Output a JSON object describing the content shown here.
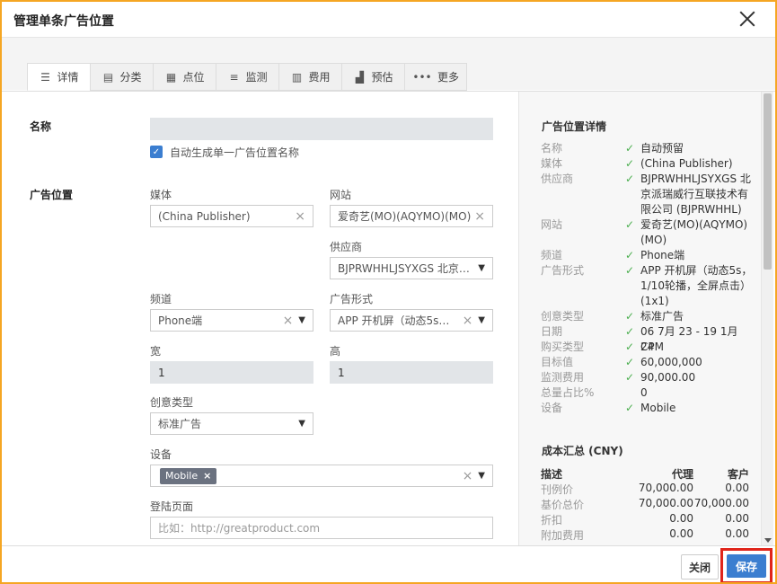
{
  "dialog": {
    "title": "管理单条广告位置"
  },
  "tabs": [
    {
      "label": "详情",
      "icon": "list-icon",
      "glyph": "☰"
    },
    {
      "label": "分类",
      "icon": "category-icon",
      "glyph": "▤"
    },
    {
      "label": "点位",
      "icon": "calendar-icon",
      "glyph": "▦"
    },
    {
      "label": "监测",
      "icon": "database-icon",
      "glyph": "≡"
    },
    {
      "label": "费用",
      "icon": "calculator-icon",
      "glyph": "▥"
    },
    {
      "label": "预估",
      "icon": "chart-icon",
      "glyph": "▟"
    },
    {
      "label": "更多",
      "icon": "more-icon",
      "glyph": "•••"
    }
  ],
  "form": {
    "name_label": "名称",
    "name_value": "",
    "auto_name_label": "自动生成单一广告位置名称",
    "placement_label": "广告位置",
    "media_label": "媒体",
    "media_value": "(China Publisher)",
    "site_label": "网站",
    "site_value": "爱奇艺(MO)(AQYMO)(MO)",
    "vendor_label": "供应商",
    "vendor_value": "BJPRWHHLJSYXGS 北京派瑞威行互联技术有限公司 (BJPRWHHL)",
    "channel_label": "频道",
    "channel_value": "Phone端",
    "format_label": "广告形式",
    "format_value": "APP 开机屏（动态5s，1/10轮播，全屏点击）(1x1)",
    "width_label": "宽",
    "width_value": "1",
    "height_label": "高",
    "height_value": "1",
    "creative_label": "创意类型",
    "creative_value": "标准广告",
    "device_label": "设备",
    "device_tag": "Mobile",
    "landing_label": "登陆页面",
    "landing_placeholder": "比如：http://greatproduct.com"
  },
  "details": {
    "title": "广告位置详情",
    "rows": [
      {
        "k": "名称",
        "v": "自动预留"
      },
      {
        "k": "媒体",
        "v": "(China Publisher)"
      },
      {
        "k": "供应商",
        "v": "BJPRWHHLJSYXGS 北京派瑞威行互联技术有限公司 (BJPRWHHL)"
      },
      {
        "k": "网站",
        "v": "爱奇艺(MO)(AQYMO)(MO)"
      },
      {
        "k": "频道",
        "v": "Phone端"
      },
      {
        "k": "广告形式",
        "v": "APP 开机屏（动态5s，1/10轮播，全屏点击）(1x1)"
      },
      {
        "k": "创意类型",
        "v": "标准广告"
      },
      {
        "k": "日期",
        "v": "06 7月 23 - 19 1月 24"
      },
      {
        "k": "购买类型",
        "v": "CPM"
      },
      {
        "k": "目标值",
        "v": "60,000,000"
      },
      {
        "k": "监测费用",
        "v": "90,000.00"
      },
      {
        "k": "总量占比%",
        "v": "0"
      },
      {
        "k": "设备",
        "v": "Mobile"
      }
    ],
    "check_flags": [
      true,
      true,
      true,
      true,
      true,
      true,
      true,
      true,
      true,
      true,
      true,
      false,
      true
    ]
  },
  "cost": {
    "title": "成本汇总 (CNY)",
    "headers": [
      "描述",
      "代理",
      "客户"
    ],
    "rows": [
      [
        "刊例价",
        "70,000.00",
        "0.00"
      ],
      [
        "基价总价",
        "70,000.00",
        "70,000.00"
      ],
      [
        "折扣",
        "0.00",
        "0.00"
      ],
      [
        "附加费用",
        "0.00",
        "0.00"
      ]
    ]
  },
  "footer": {
    "close_label": "关闭",
    "save_label": "保存"
  },
  "colors": {
    "primary": "#3b7ed0",
    "highlight": "#e0251b",
    "check": "#4caf50",
    "outer": "#f5a623"
  }
}
